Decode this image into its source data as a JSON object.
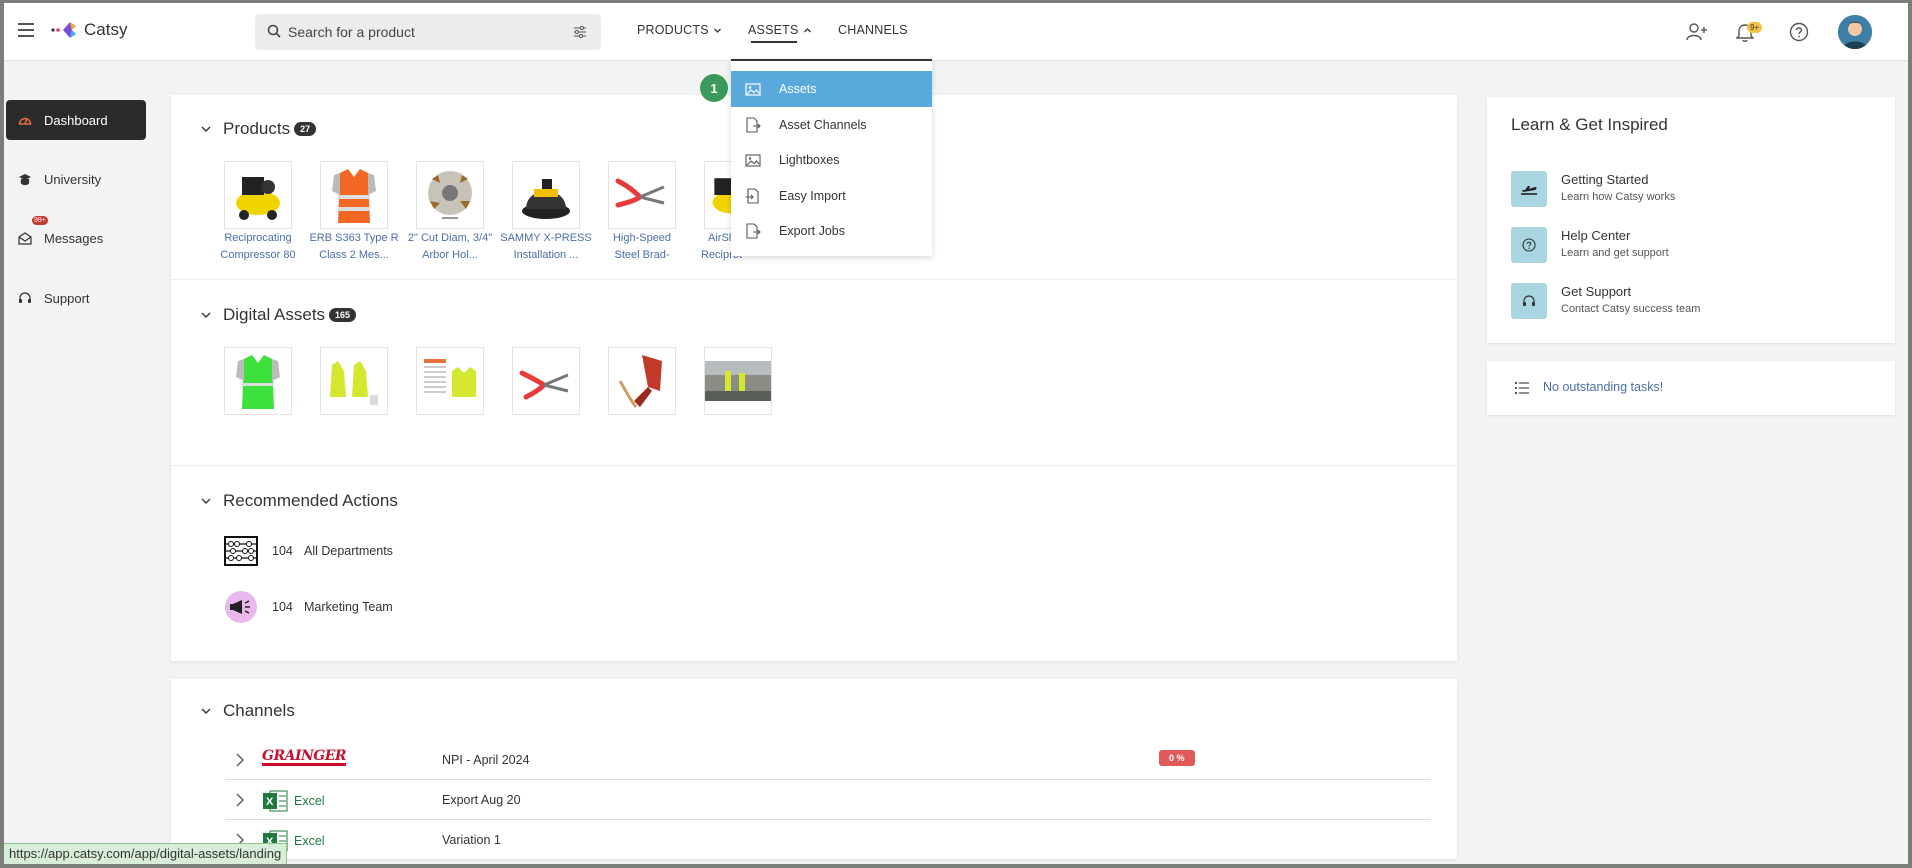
{
  "header": {
    "app_name": "Catsy",
    "search_placeholder": "Search for a product",
    "nav": {
      "products": "PRODUCTS",
      "assets": "ASSETS",
      "channels": "CHANNELS"
    },
    "notification_badge": "9+"
  },
  "sidebar": {
    "items": [
      {
        "label": "Dashboard",
        "icon": "dashboard-icon"
      },
      {
        "label": "University",
        "icon": "graduation-icon"
      },
      {
        "label": "Messages",
        "icon": "inbox-icon",
        "badge": "99+"
      },
      {
        "label": "Support",
        "icon": "headset-icon"
      }
    ]
  },
  "assets_menu": {
    "step_marker": "1",
    "items": [
      {
        "label": "Assets",
        "icon": "image-icon"
      },
      {
        "label": "Asset Channels",
        "icon": "file-export-icon"
      },
      {
        "label": "Lightboxes",
        "icon": "images-icon"
      },
      {
        "label": "Easy Import",
        "icon": "file-import-icon"
      },
      {
        "label": "Export Jobs",
        "icon": "file-export-icon"
      }
    ]
  },
  "products": {
    "title": "Products",
    "count": "27",
    "items": [
      {
        "line1": "Reciprocating",
        "line2": "Compressor 80"
      },
      {
        "line1": "ERB S363 Type R",
        "line2": "Class 2 Mes..."
      },
      {
        "line1": "2\" Cut Diam, 3/4\"",
        "line2": "Arbor Hol..."
      },
      {
        "line1": "SAMMY X-PRESS",
        "line2": "Installation ..."
      },
      {
        "line1": "High-Speed",
        "line2": "Steel Brad-"
      },
      {
        "line1": "AirSh...",
        "line2": "Reciprocating"
      }
    ]
  },
  "digital_assets": {
    "title": "Digital Assets",
    "count": "165"
  },
  "recommended_actions": {
    "title": "Recommended Actions",
    "items": [
      {
        "count": "104",
        "label": "All Departments"
      },
      {
        "count": "104",
        "label": "Marketing Team"
      }
    ]
  },
  "channels": {
    "title": "Channels",
    "rows": [
      {
        "logo": "GRAINGER",
        "name": "NPI - April 2024",
        "progress": "0 %"
      },
      {
        "logo": "Excel",
        "name": "Export Aug 20"
      },
      {
        "logo": "Excel",
        "name": "Variation 1"
      }
    ]
  },
  "learn": {
    "title": "Learn & Get Inspired",
    "items": [
      {
        "title": "Getting Started",
        "subtitle": "Learn how Catsy works"
      },
      {
        "title": "Help Center",
        "subtitle": "Learn and get support"
      },
      {
        "title": "Get Support",
        "subtitle": "Contact Catsy success team"
      }
    ]
  },
  "tasks": {
    "text": "No outstanding tasks!"
  },
  "status_bar": {
    "url": "https://app.catsy.com/app/digital-assets/landing"
  },
  "colors": {
    "accent": "#5aa9dc",
    "active_nav": "#2b2b2b",
    "progress_bad": "#e15a5a",
    "step": "#3b9a5b"
  }
}
